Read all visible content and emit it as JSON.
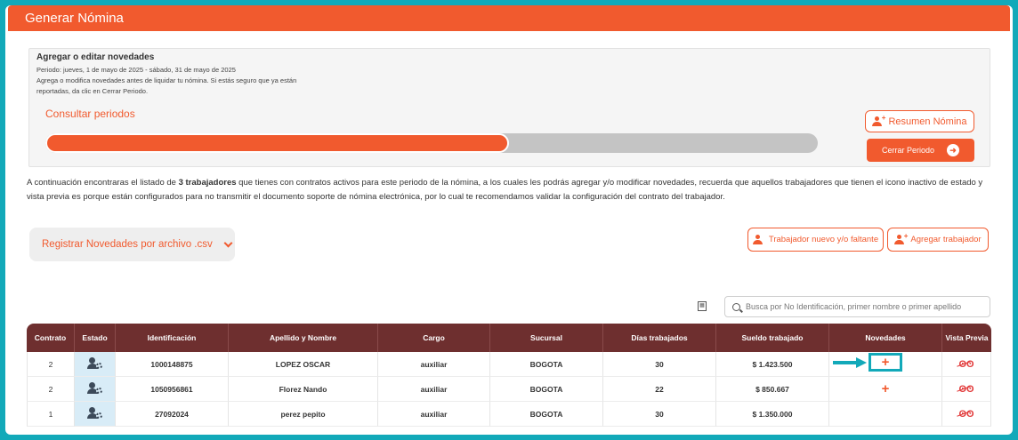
{
  "header": {
    "title": "Generar Nómina"
  },
  "period": {
    "heading": "Agregar o editar novedades",
    "range": "Periodo: jueves, 1 de mayo de 2025 - sábado, 31 de mayo de 2025",
    "notice_line1": "Agrega o modifica novedades antes de liquidar tu nómina. Si estás seguro que ya están",
    "notice_line2": "reportadas, da clic en Cerrar Periodo.",
    "consultar_label": "Consultar periodos",
    "progress": 0.6
  },
  "actions": {
    "resumen_label": "Resumen Nómina",
    "cerrar_label": "Cerrar Periodo"
  },
  "info": {
    "part1": "A continuación encontraras el listado de ",
    "bold": "3 trabajadores",
    "part2": " que tienes con contratos activos para este periodo de la nómina, a los cuales les podrás agregar y/o modificar novedades, recuerda que aquellos trabajadores que tienen el icono inactivo de estado y vista previa es porque están configurados para no transmitir el documento soporte de nómina electrónica, por lo cual te recomendamos validar la configuración del contrato del trabajador."
  },
  "csv": {
    "label": "Registrar Novedades por archivo .csv"
  },
  "buttons": {
    "nuevo_label": "Trabajador nuevo y/o faltante",
    "agregar_label": "Agregar trabajador"
  },
  "search": {
    "placeholder": "Busca por No Identificación, primer nombre o primer apellido",
    "value": ""
  },
  "table": {
    "headers": [
      "Contrato",
      "Estado",
      "Identificación",
      "Apellido y Nombre",
      "Cargo",
      "Sucursal",
      "Días trabajados",
      "Sueldo trabajado",
      "Novedades",
      "Vista Previa"
    ],
    "rows": [
      {
        "contrato": "2",
        "identificacion": "1000148875",
        "nombre": "LOPEZ OSCAR",
        "cargo": "auxiliar",
        "sucursal": "BOGOTA",
        "dias": "30",
        "sueldo": "$ 1.423.500",
        "novedades": "+"
      },
      {
        "contrato": "2",
        "identificacion": "1050956861",
        "nombre": "Florez Nando",
        "cargo": "auxiliar",
        "sucursal": "BOGOTA",
        "dias": "22",
        "sueldo": "$ 850.667",
        "novedades": "+"
      },
      {
        "contrato": "1",
        "identificacion": "27092024",
        "nombre": "perez pepito",
        "cargo": "auxiliar",
        "sucursal": "BOGOTA",
        "dias": "30",
        "sueldo": "$ 1.350.000",
        "novedades": ""
      }
    ]
  },
  "icons": {
    "user_add": "user-plus-icon",
    "arrow_right": "arrow-circle-right-icon",
    "user_gear": "user-gear-icon",
    "glasses": "glasses-slash-icon",
    "export": "export-csv-icon",
    "search": "search-icon"
  },
  "colors": {
    "accent": "#f15a2e",
    "table_header": "#6e2f2f",
    "highlight": "#12a9b9",
    "estado_bg": "#d8ecf7"
  }
}
